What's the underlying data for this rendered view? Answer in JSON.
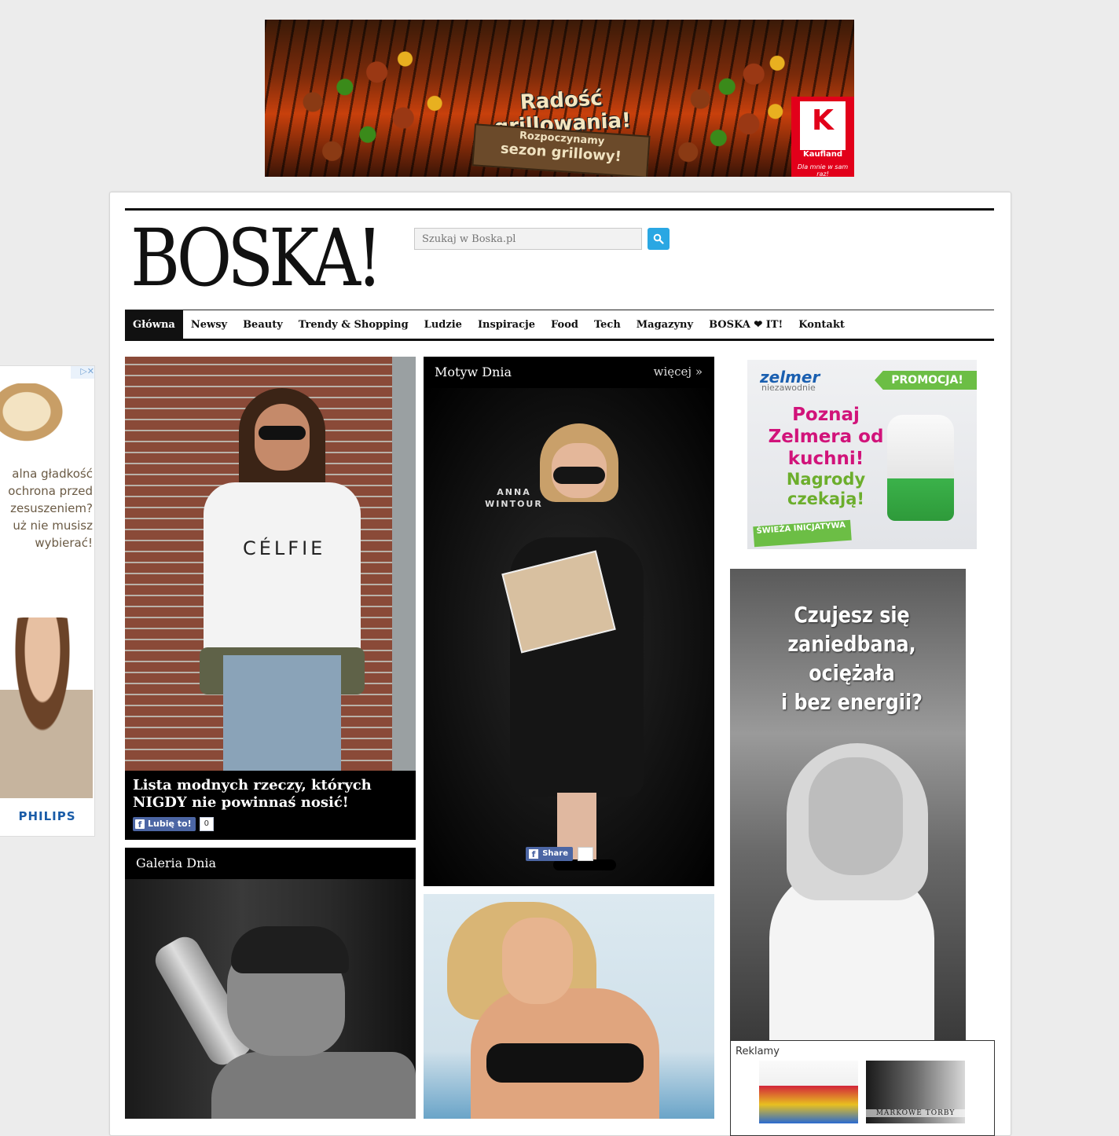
{
  "top_banner": {
    "title": "Radość grillowania!",
    "subtitle_line1": "Rozpoczynamy",
    "subtitle_line2": "sezon grillowy!",
    "brand": "Kaufland",
    "brand_mark": "K",
    "slogan": "Dla mnie w sam raz!"
  },
  "header": {
    "logo": "BOSKA!",
    "search": {
      "placeholder": "Szukaj w Boska.pl"
    }
  },
  "nav": {
    "items": [
      "Główna",
      "Newsy",
      "Beauty",
      "Trendy & Shopping",
      "Ludzie",
      "Inspiracje",
      "Food",
      "Tech",
      "Magazyny",
      "BOSKA ❤ IT!",
      "Kontakt"
    ],
    "active_index": 0
  },
  "side_ad": {
    "adchoices": "▷✕",
    "copy": [
      "alna gładkość",
      "ochrona przed",
      "zesuszeniem?",
      "uż nie musisz",
      "wybierać!"
    ],
    "brand": "PHILIPS"
  },
  "feature_1": {
    "shirt_text": "CÉLFIE",
    "title": "Lista modnych rzeczy, których NIGDY nie powinnaś nosić!",
    "like_label": "Lubię to!",
    "like_count": "0"
  },
  "motyw_dnia": {
    "heading": "Motyw Dnia",
    "more_link": "więcej »",
    "photo_caption": "ANNA WINTOUR",
    "share_label": "Share"
  },
  "galeria_dnia": {
    "heading": "Galeria Dnia"
  },
  "zelmer_ad": {
    "brand": "zelmer",
    "tagline": "niezawodnie",
    "promo": "PROMOCJA!",
    "headline": "Poznaj Zelmera od kuchni!",
    "subheadline": "Nagrody czekają!",
    "badge": "ŚWIEŻA INICJATYWA"
  },
  "czujesz_ad": {
    "lines": [
      "Czujesz się",
      "zaniedbana,",
      "ociężała",
      "i bez energii?"
    ]
  },
  "reklamy": {
    "label": "Reklamy",
    "thumb2_text": "MARKOWE TORBY"
  }
}
